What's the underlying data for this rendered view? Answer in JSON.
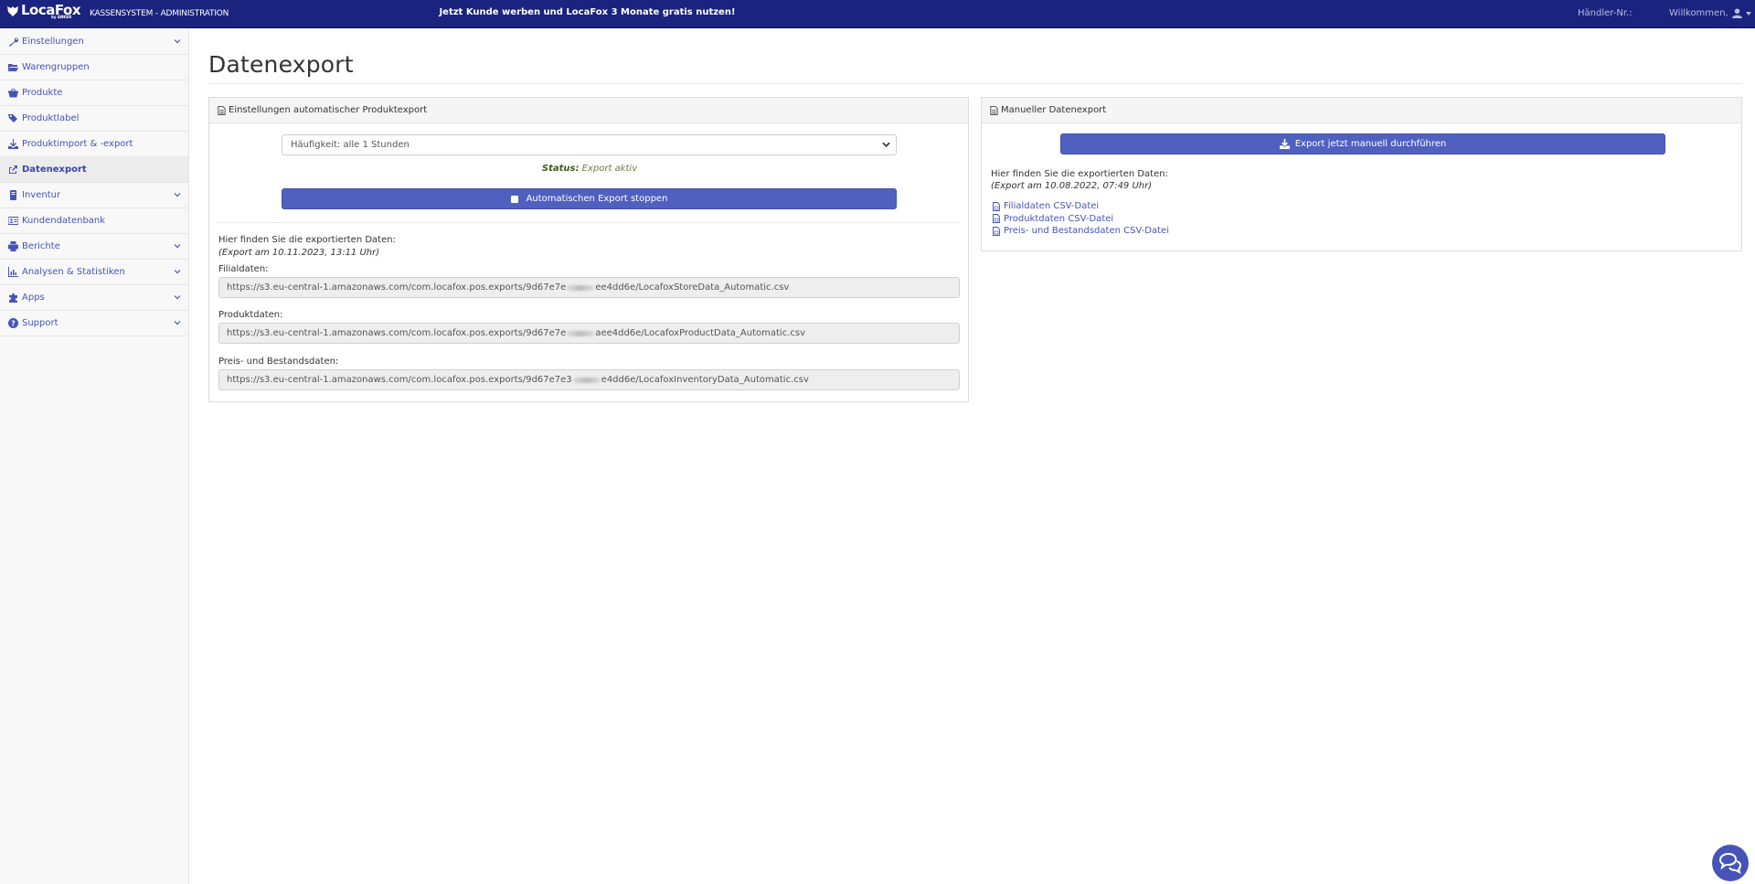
{
  "header": {
    "logo_text": "LocaFox",
    "logo_sub": "by ANKER",
    "app_title": "KASSENSYSTEM - ADMINISTRATION",
    "promo": "Jetzt Kunde werben und LocaFox 3 Monate gratis nutzen!",
    "haendler_label": "Händler-Nr.:",
    "welcome_label": "Willkommen,",
    "brand_color": "#1a237e"
  },
  "sidebar": {
    "items": [
      {
        "label": "Einstellungen",
        "icon": "wrench-icon",
        "expandable": true
      },
      {
        "label": "Warengruppen",
        "icon": "folder-open-icon",
        "expandable": false
      },
      {
        "label": "Produkte",
        "icon": "basket-icon",
        "expandable": false
      },
      {
        "label": "Produktlabel",
        "icon": "tags-icon",
        "expandable": false
      },
      {
        "label": "Produktimport & -export",
        "icon": "download-icon",
        "expandable": false
      },
      {
        "label": "Datenexport",
        "icon": "share-square-icon",
        "expandable": false,
        "active": true
      },
      {
        "label": "Inventur",
        "icon": "book-icon",
        "expandable": true
      },
      {
        "label": "Kundendatenbank",
        "icon": "address-card-icon",
        "expandable": false
      },
      {
        "label": "Berichte",
        "icon": "print-icon",
        "expandable": true
      },
      {
        "label": "Analysen & Statistiken",
        "icon": "chart-icon",
        "expandable": true
      },
      {
        "label": "Apps",
        "icon": "puzzle-icon",
        "expandable": true
      },
      {
        "label": "Support",
        "icon": "question-circle-icon",
        "expandable": true
      }
    ]
  },
  "page": {
    "title": "Datenexport"
  },
  "auto_export": {
    "title": "Einstellungen automatischer Produktexport",
    "frequency_value": "Häufigkeit: alle 1 Stunden",
    "status_label": "Status:",
    "status_value": "Export aktiv",
    "stop_button": "Automatischen Export stoppen",
    "info": "Hier finden Sie die exportierten Daten:",
    "export_date": "(Export am 10.11.2023, 13:11 Uhr)",
    "fields": [
      {
        "label": "Filialdaten:",
        "url_prefix": "https://s3.eu-central-1.amazonaws.com/com.locafox.pos.exports/9d67e7e",
        "url_suffix": "ee4dd6e/LocafoxStoreData_Automatic.csv"
      },
      {
        "label": "Produktdaten:",
        "url_prefix": "https://s3.eu-central-1.amazonaws.com/com.locafox.pos.exports/9d67e7e",
        "url_suffix": "aee4dd6e/LocafoxProductData_Automatic.csv"
      },
      {
        "label": "Preis- und Bestandsdaten:",
        "url_prefix": "https://s3.eu-central-1.amazonaws.com/com.locafox.pos.exports/9d67e7e3",
        "url_suffix": "e4dd6e/LocafoxInventoryData_Automatic.csv"
      }
    ]
  },
  "manual_export": {
    "title": "Manueller Datenexport",
    "button": "Export jetzt manuell durchführen",
    "info": "Hier finden Sie die exportierten Daten:",
    "export_date": "(Export am 10.08.2022, 07:49 Uhr)",
    "links": [
      "Filialdaten CSV-Datei",
      "Produktdaten CSV-Datei",
      "Preis- und Bestandsdaten CSV-Datei"
    ]
  },
  "accent_color": "#5060bf"
}
